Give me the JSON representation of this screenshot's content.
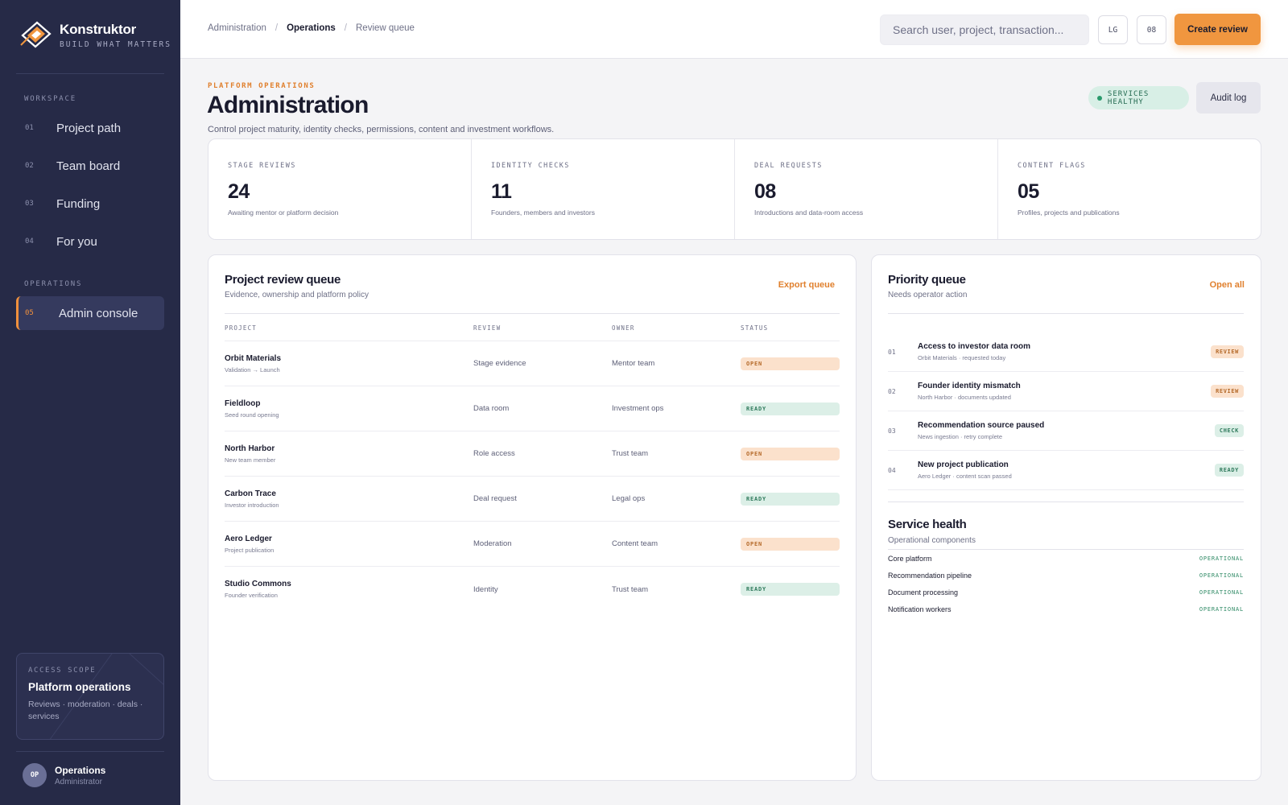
{
  "brand": {
    "name": "Konstruktor",
    "tagline": "BUILD WHAT MATTERS",
    "accent": "#f0963f"
  },
  "sidebar": {
    "sections": {
      "workspace": "WORKSPACE",
      "operations": "OPERATIONS"
    },
    "items": [
      {
        "num": "01",
        "label": "Project path",
        "icon": "nav-index"
      },
      {
        "num": "02",
        "label": "Team board",
        "icon": "nav-index"
      },
      {
        "num": "03",
        "label": "Funding",
        "icon": "nav-index"
      },
      {
        "num": "04",
        "label": "For you",
        "icon": "nav-index"
      },
      {
        "num": "05",
        "label": "Admin console",
        "icon": "nav-index",
        "active": true
      }
    ],
    "scope": {
      "label": "ACCESS SCOPE",
      "title": "Platform operations",
      "desc": "Reviews · moderation · deals · services"
    },
    "user": {
      "initials": "OP",
      "name": "Operations",
      "role": "Administrator"
    }
  },
  "topbar": {
    "breadcrumbs": [
      "Administration",
      "Operations",
      "Review queue"
    ],
    "search_placeholder": "Search user, project, transaction...",
    "lang_label": "LG",
    "notif_count": "08",
    "create_label": "Create review"
  },
  "header": {
    "eyebrow": "PLATFORM OPERATIONS",
    "title": "Administration",
    "desc": "Control project maturity, identity checks, permissions, content and investment workflows.",
    "health_label": "SERVICES HEALTHY",
    "audit_label": "Audit log"
  },
  "stats": [
    {
      "label": "STAGE REVIEWS",
      "value": "24",
      "note": "Awaiting mentor or platform decision"
    },
    {
      "label": "IDENTITY CHECKS",
      "value": "11",
      "note": "Founders, members and investors"
    },
    {
      "label": "DEAL REQUESTS",
      "value": "08",
      "note": "Introductions and data-room access"
    },
    {
      "label": "CONTENT FLAGS",
      "value": "05",
      "note": "Profiles, projects and publications"
    }
  ],
  "review_queue": {
    "title": "Project review queue",
    "subtitle": "Evidence, ownership and platform policy",
    "action": "Export queue",
    "columns": [
      "PROJECT",
      "REVIEW",
      "OWNER",
      "STATUS"
    ],
    "rows": [
      {
        "project": "Orbit Materials",
        "sub": "Validation → Launch",
        "review": "Stage evidence",
        "owner": "Mentor team",
        "status": "OPEN"
      },
      {
        "project": "Fieldloop",
        "sub": "Seed round opening",
        "review": "Data room",
        "owner": "Investment ops",
        "status": "READY"
      },
      {
        "project": "North Harbor",
        "sub": "New team member",
        "review": "Role access",
        "owner": "Trust team",
        "status": "OPEN"
      },
      {
        "project": "Carbon Trace",
        "sub": "Investor introduction",
        "review": "Deal request",
        "owner": "Legal ops",
        "status": "READY"
      },
      {
        "project": "Aero Ledger",
        "sub": "Project publication",
        "review": "Moderation",
        "owner": "Content team",
        "status": "OPEN"
      },
      {
        "project": "Studio Commons",
        "sub": "Founder verification",
        "review": "Identity",
        "owner": "Trust team",
        "status": "READY"
      }
    ]
  },
  "priority_queue": {
    "title": "Priority queue",
    "subtitle": "Needs operator action",
    "action": "Open all",
    "items": [
      {
        "num": "01",
        "title": "Access to investor data room",
        "sub": "Orbit Materials · requested today",
        "badge": "REVIEW"
      },
      {
        "num": "02",
        "title": "Founder identity mismatch",
        "sub": "North Harbor · documents updated",
        "badge": "REVIEW"
      },
      {
        "num": "03",
        "title": "Recommendation source paused",
        "sub": "News ingestion · retry complete",
        "badge": "CHECK"
      },
      {
        "num": "04",
        "title": "New project publication",
        "sub": "Aero Ledger · content scan passed",
        "badge": "READY"
      }
    ]
  },
  "service_health": {
    "title": "Service health",
    "subtitle": "Operational components",
    "items": [
      {
        "name": "Core platform",
        "state": "OPERATIONAL"
      },
      {
        "name": "Recommendation pipeline",
        "state": "OPERATIONAL"
      },
      {
        "name": "Document processing",
        "state": "OPERATIONAL"
      },
      {
        "name": "Notification workers",
        "state": "OPERATIONAL"
      }
    ]
  }
}
